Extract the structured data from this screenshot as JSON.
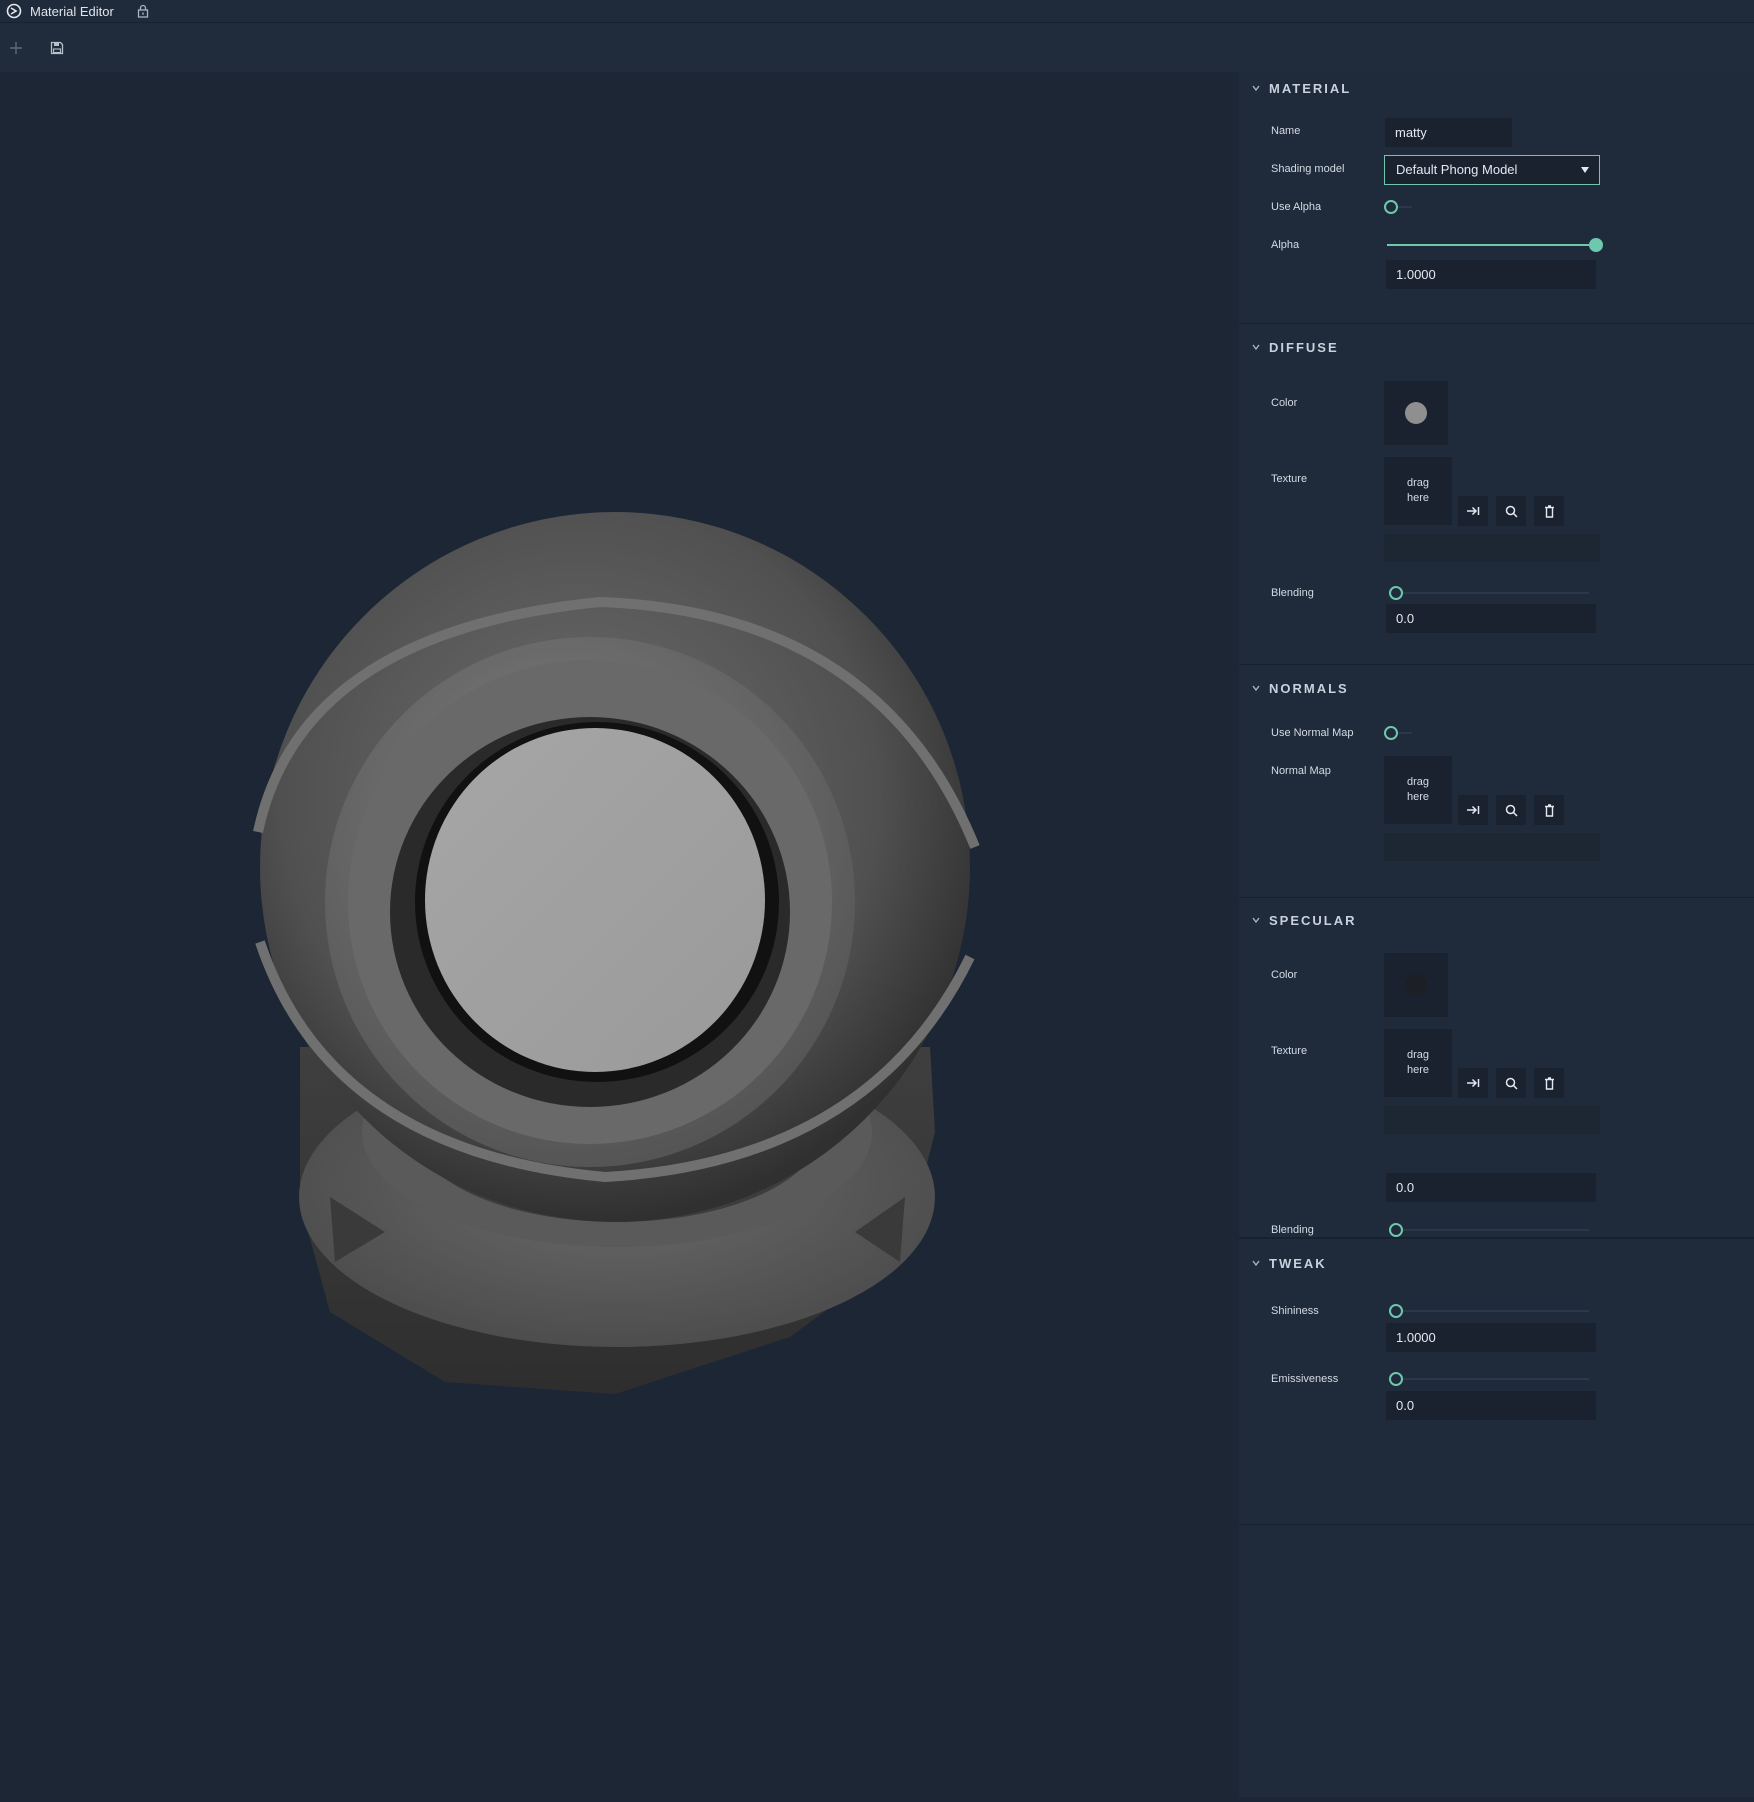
{
  "window": {
    "title": "Material Editor"
  },
  "toolbar": {
    "add_icon": "plus-icon",
    "save_icon": "save-icon"
  },
  "material": {
    "header": "MATERIAL",
    "name_label": "Name",
    "name_value": "matty",
    "shading_label": "Shading model",
    "shading_value": "Default Phong Model",
    "use_alpha_label": "Use Alpha",
    "use_alpha": false,
    "alpha_label": "Alpha",
    "alpha_value": "1.0000",
    "alpha_level": 1.0
  },
  "diffuse": {
    "header": "DIFFUSE",
    "color_label": "Color",
    "color": "#8f8f8f",
    "texture_label": "Texture",
    "drop_line1": "drag",
    "drop_line2": "here",
    "blending_label": "Blending",
    "blending_value": "0.0",
    "blending_level": 0.0
  },
  "normals": {
    "header": "NORMALS",
    "use_normal_map_label": "Use Normal Map",
    "use_normal_map": false,
    "normal_map_label": "Normal Map",
    "drop_line1": "drag",
    "drop_line2": "here"
  },
  "specular": {
    "header": "SPECULAR",
    "color_label": "Color",
    "color": "#1c1f24",
    "texture_label": "Texture",
    "drop_line1": "drag",
    "drop_line2": "here",
    "blending_label": "Blending",
    "blending_value": "0.0",
    "blending_level": 0.0
  },
  "tweak": {
    "header": "TWEAK",
    "shininess_label": "Shininess",
    "shininess_value": "1.0000",
    "shininess_level": 0.0,
    "emissiveness_label": "Emissiveness",
    "emissiveness_value": "0.0",
    "emissiveness_level": 0.0
  },
  "colors": {
    "accent": "#6ec8ad",
    "panel": "#1f2a3a",
    "viewport": "#1c2635"
  }
}
